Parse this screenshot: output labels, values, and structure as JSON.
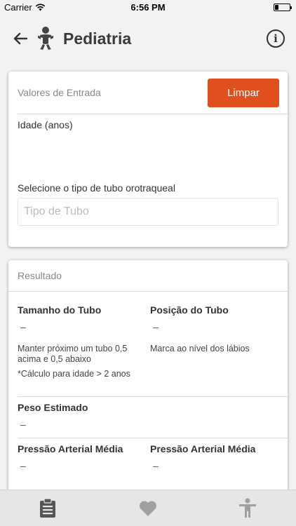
{
  "status_bar": {
    "carrier": "Carrier",
    "time": "6:56 PM",
    "battery_level": 0.25
  },
  "nav": {
    "title": "Pediatria",
    "back_icon": "arrow-left-icon",
    "title_icon": "baby-icon",
    "info_icon": "info-icon",
    "info_glyph": "i"
  },
  "input_card": {
    "header": "Valores de Entrada",
    "clear_label": "Limpar",
    "age_label": "Idade (anos)",
    "age_value": "",
    "tube_label": "Selecione o tipo de tubo orotraqueal",
    "tube_placeholder": "Tipo de Tubo"
  },
  "result_card": {
    "header": "Resultado",
    "tube_size": {
      "label": "Tamanho do Tubo",
      "value": "–",
      "note_line1": "Manter próximo um tubo 0,5",
      "note_line2": "acima e 0,5 abaixo",
      "note_line3": "*Cálculo para idade > 2 anos"
    },
    "tube_position": {
      "label": "Posição do Tubo",
      "value": "–",
      "note": "Marca ao nível dos lábios"
    },
    "estimated_weight": {
      "label": "Peso Estimado",
      "value": "–"
    },
    "map_left": {
      "label": "Pressão Arterial Média",
      "value": "–"
    },
    "map_right": {
      "label": "Pressão Arterial Média",
      "value": "–"
    }
  },
  "tab_bar": {
    "tabs": [
      {
        "icon": "clipboard-icon",
        "active": true
      },
      {
        "icon": "heart-icon",
        "active": false
      },
      {
        "icon": "person-icon",
        "active": false
      }
    ]
  },
  "colors": {
    "accent": "#e0501e",
    "tab_active": "#555555",
    "tab_inactive": "#a0a0a0"
  }
}
